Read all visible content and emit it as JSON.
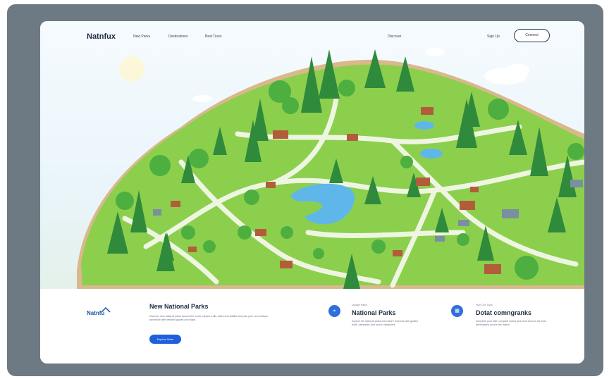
{
  "colors": {
    "frame": "#6d7a84",
    "accent": "#1d5fdc",
    "heading": "#1e2c44",
    "grass": "#8ccf4d",
    "path": "#eef6e2",
    "water": "#5fb7e9"
  },
  "nav": {
    "brand": "Natnfux",
    "links": [
      "New Parks",
      "Destinations",
      "Best Tours"
    ],
    "center_link": "Discover",
    "sign_in_link": "Sign Up",
    "cta_button": "Connect"
  },
  "footer": {
    "logo": "Natnfu",
    "title": "New National Parks",
    "description": "Discover new national parks around the world, explore trails, lakes and wildlife and plan your next outdoor adventure with detailed guides and maps.",
    "button": "Explore More",
    "cards": [
      {
        "icon": "location-pin-icon",
        "kicker": "Update Parks",
        "title": "National Parks",
        "description": "Explore the national parks and nature reserves with guided trails, campsites and scenic viewpoints."
      },
      {
        "icon": "calendar-icon",
        "kicker": "Plan Our Tours",
        "title": "Dotat comngranks",
        "description": "Schedule your visit, compare routes and book tours to the best destinations across the region."
      }
    ]
  }
}
